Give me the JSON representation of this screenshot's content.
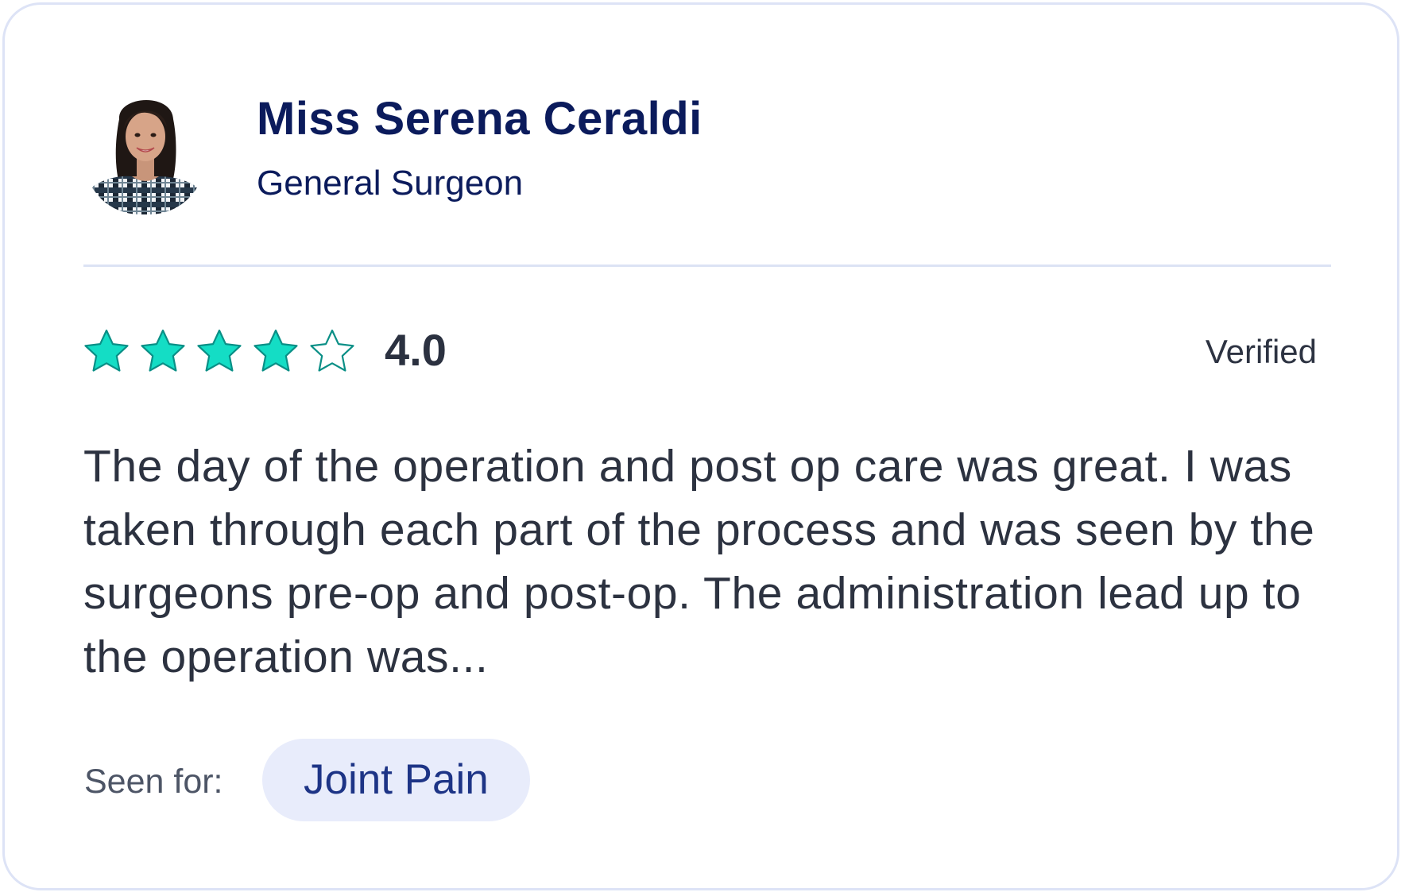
{
  "doctor": {
    "name": "Miss Serena Ceraldi",
    "specialty": "General Surgeon",
    "avatar_icon": "doctor-portrait"
  },
  "review": {
    "rating": 4,
    "max_rating": 5,
    "rating_label": "4.0",
    "verified_label": "Verified",
    "text": "The day of the operation and post op care was great. I was taken through each part of the process and was seen by the surgeons pre-op and post-op. The administration lead up to the operation was...",
    "seen_for_label": "Seen for:",
    "seen_for_tag": "Joint Pain"
  },
  "colors": {
    "star_filled": "#14ddc5",
    "star_outline": "#0a8f86",
    "name": "#0b1b5c",
    "chip_bg": "#e8ecfb",
    "chip_text": "#1d3486",
    "border": "#dde3f6"
  },
  "icons": {
    "star_filled": "star-filled-icon",
    "star_empty": "star-outline-icon"
  }
}
